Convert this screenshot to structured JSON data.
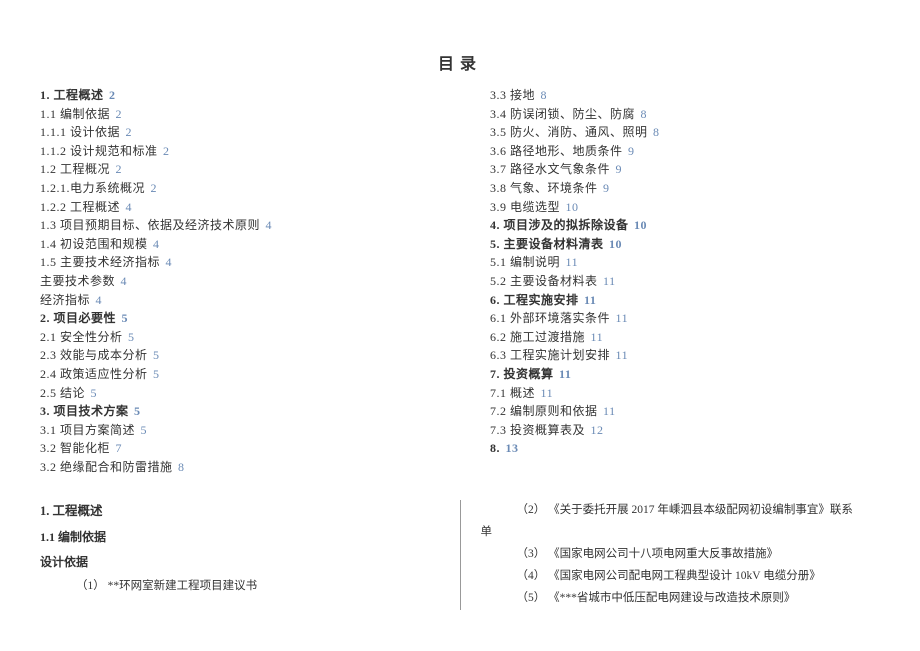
{
  "title": "目录",
  "toc_left": [
    {
      "text": "1. 工程概述",
      "page": "2",
      "bold": true
    },
    {
      "text": "1.1 编制依据",
      "page": "2"
    },
    {
      "text": "1.1.1 设计依据",
      "page": "2"
    },
    {
      "text": "1.1.2 设计规范和标准",
      "page": "2"
    },
    {
      "text": "1.2 工程概况",
      "page": "2"
    },
    {
      "text": "1.2.1.电力系统概况",
      "page": "2"
    },
    {
      "text": "1.2.2 工程概述",
      "page": "4"
    },
    {
      "text": "1.3 项目预期目标、依据及经济技术原则",
      "page": "4"
    },
    {
      "text": "1.4 初设范围和规模",
      "page": "4"
    },
    {
      "text": "1.5 主要技术经济指标",
      "page": "4"
    },
    {
      "text": "主要技术参数",
      "page": "4"
    },
    {
      "text": "经济指标",
      "page": "4"
    },
    {
      "text": "2. 项目必要性",
      "page": "5",
      "bold": true
    },
    {
      "text": "2.1 安全性分析",
      "page": "5"
    },
    {
      "text": "2.3 效能与成本分析",
      "page": "5"
    },
    {
      "text": "2.4 政策适应性分析",
      "page": "5"
    },
    {
      "text": "2.5 结论",
      "page": "5"
    },
    {
      "text": "3. 项目技术方案",
      "page": "5",
      "bold": true
    },
    {
      "text": "3.1 项目方案简述",
      "page": "5"
    },
    {
      "text": "3.2 智能化柜",
      "page": "7"
    },
    {
      "text": "3.2 绝缘配合和防雷措施",
      "page": "8"
    }
  ],
  "toc_right": [
    {
      "text": "3.3 接地",
      "page": "8"
    },
    {
      "text": "3.4 防误闭锁、防尘、防腐",
      "page": "8"
    },
    {
      "text": "3.5 防火、消防、通风、照明",
      "page": "8"
    },
    {
      "text": "3.6 路径地形、地质条件",
      "page": "9"
    },
    {
      "text": "3.7 路径水文气象条件",
      "page": "9"
    },
    {
      "text": "3.8 气象、环境条件",
      "page": "9"
    },
    {
      "text": "3.9 电缆选型",
      "page": "10"
    },
    {
      "text": "4. 项目涉及的拟拆除设备",
      "page": "10",
      "bold": true
    },
    {
      "text": "5. 主要设备材料清表",
      "page": "10",
      "bold": true
    },
    {
      "text": "5.1 编制说明",
      "page": "11"
    },
    {
      "text": "5.2 主要设备材料表",
      "page": "11"
    },
    {
      "text": "6. 工程实施安排",
      "page": "11",
      "bold": true
    },
    {
      "text": "6.1 外部环境落实条件",
      "page": "11"
    },
    {
      "text": "6.2 施工过渡措施",
      "page": "11"
    },
    {
      "text": "6.3 工程实施计划安排",
      "page": "11"
    },
    {
      "text": "7. 投资概算",
      "page": "11",
      "bold": true
    },
    {
      "text": "7.1 概述",
      "page": "11"
    },
    {
      "text": "7.2 编制原则和依据",
      "page": "11"
    },
    {
      "text": "7.3 投资概算表及",
      "page": "12"
    },
    {
      "text": "8.",
      "page": "13",
      "bold": true
    }
  ],
  "body_left": {
    "h1": "1. 工程概述",
    "h2": "1.1 编制依据",
    "h3": "设计依据",
    "item1": "（1）  **环网室新建工程项目建议书"
  },
  "body_right": {
    "item2a": "（2）  《关于委托开展 2017 年嵊泗县本级配网初设编制事宜》联系",
    "item2b": "单",
    "item3": "（3）  《国家电网公司十八项电网重大反事故措施》",
    "item4": "（4）  《国家电网公司配电网工程典型设计 10kV 电缆分册》",
    "item5": "（5）  《***省城市中低压配电网建设与改造技术原则》"
  }
}
